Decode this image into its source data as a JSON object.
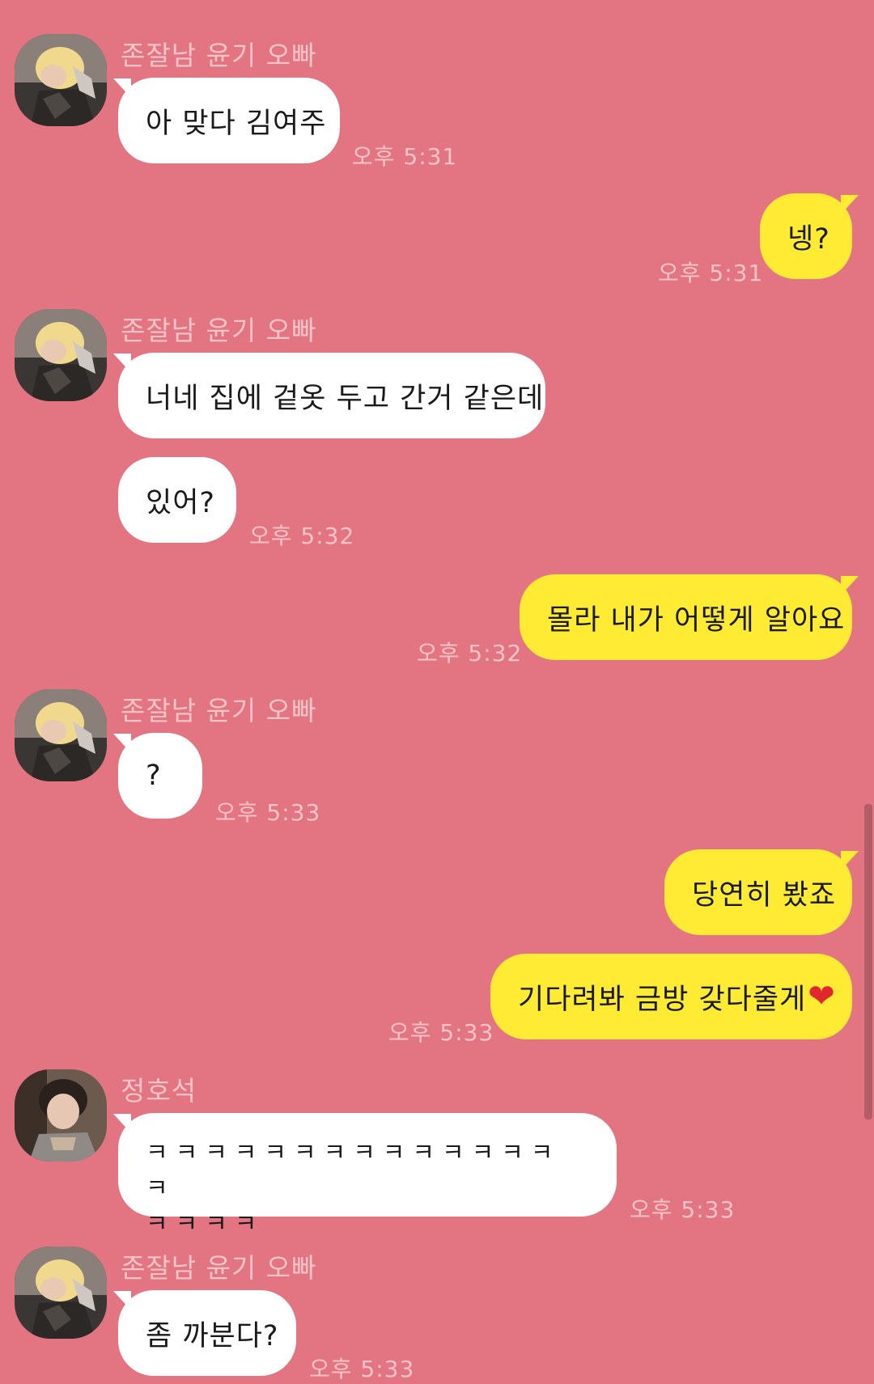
{
  "senders": {
    "yoongi": "존잘남 윤기 오빠",
    "hoseok": "정호석"
  },
  "messages": [
    {
      "text": "아 맞다 김여주",
      "time": "오후 5:31"
    },
    {
      "text": "넹?",
      "time": "오후 5:31"
    },
    {
      "text": "너네 집에 겉옷 두고 간거 같은데"
    },
    {
      "text": "있어?",
      "time": "오후 5:32"
    },
    {
      "text": "몰라 내가 어떻게 알아요",
      "time": "오후 5:32"
    },
    {
      "text": "?",
      "time": "오후 5:33"
    },
    {
      "text": "당연히 봤죠"
    },
    {
      "text": "기다려봐 금방 갖다줄게",
      "emoji": "❤",
      "time": "오후 5:33"
    },
    {
      "line1": "ㅋㅋㅋㅋㅋㅋㅋㅋㅋㅋㅋㅋㅋㅋㅋ",
      "line2": "ㅋㅋㅋㅋ",
      "time": "오후 5:33"
    },
    {
      "text": "좀 까분다?",
      "time": "오후 5:33"
    }
  ],
  "colors": {
    "background": "#e27581",
    "incoming_bubble": "#ffffff",
    "outgoing_bubble": "#ffeb33",
    "meta_text": "#f6c3c9"
  },
  "icons": {
    "yoongi_avatar": "profile-photo-blond",
    "hoseok_avatar": "profile-photo-dark-hair"
  }
}
